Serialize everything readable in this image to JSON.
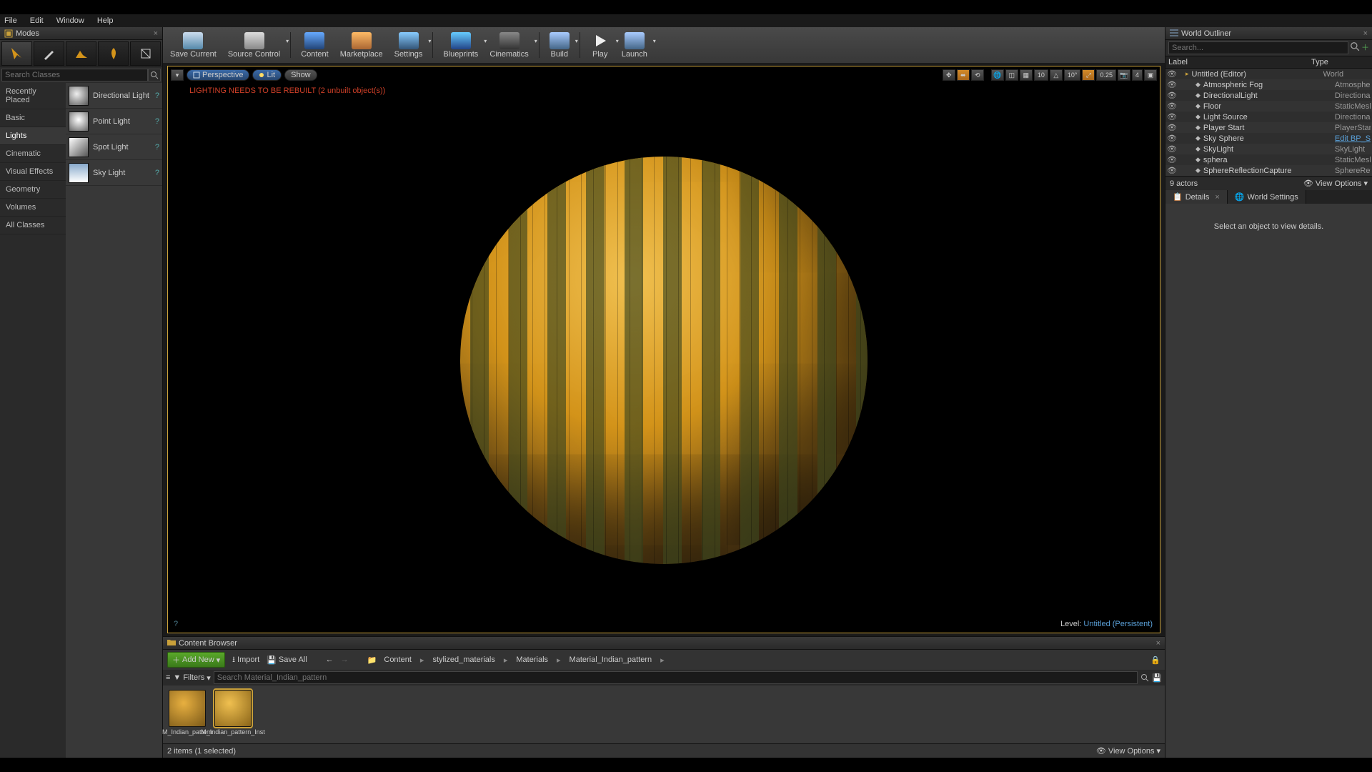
{
  "menu": {
    "file": "File",
    "edit": "Edit",
    "window": "Window",
    "help": "Help"
  },
  "modes": {
    "tab": "Modes",
    "search_placeholder": "Search Classes",
    "categories": [
      "Recently Placed",
      "Basic",
      "Lights",
      "Cinematic",
      "Visual Effects",
      "Geometry",
      "Volumes",
      "All Classes"
    ],
    "selected_category": "Lights",
    "lights": [
      "Directional Light",
      "Point Light",
      "Spot Light",
      "Sky Light"
    ]
  },
  "toolbar": {
    "save": "Save Current",
    "source": "Source Control",
    "content": "Content",
    "marketplace": "Marketplace",
    "settings": "Settings",
    "blueprints": "Blueprints",
    "cinematics": "Cinematics",
    "build": "Build",
    "play": "Play",
    "launch": "Launch"
  },
  "viewport": {
    "perspective": "Perspective",
    "lit": "Lit",
    "show": "Show",
    "warning": "LIGHTING NEEDS TO BE REBUILT (2 unbuilt object(s))",
    "snap_deg": "10",
    "snap_deg2": "10°",
    "snap_scale": "0.25",
    "cam_speed": "4",
    "level_label": "Level:",
    "level_name": "Untitled (Persistent)"
  },
  "outliner": {
    "tab": "World Outliner",
    "search_placeholder": "Search...",
    "col_label": "Label",
    "col_type": "Type",
    "rows": [
      {
        "indent": 0,
        "name": "Untitled (Editor)",
        "type": "World"
      },
      {
        "indent": 1,
        "name": "Atmospheric Fog",
        "type": "AtmosphericFog"
      },
      {
        "indent": 1,
        "name": "DirectionalLight",
        "type": "DirectionalLight"
      },
      {
        "indent": 1,
        "name": "Floor",
        "type": "StaticMeshActor"
      },
      {
        "indent": 1,
        "name": "Light Source",
        "type": "DirectionalLight"
      },
      {
        "indent": 1,
        "name": "Player Start",
        "type": "PlayerStart"
      },
      {
        "indent": 1,
        "name": "Sky Sphere",
        "type": "Edit BP_Sky_Sphere",
        "link": true
      },
      {
        "indent": 1,
        "name": "SkyLight",
        "type": "SkyLight"
      },
      {
        "indent": 1,
        "name": "sphera",
        "type": "StaticMeshActor"
      },
      {
        "indent": 1,
        "name": "SphereReflectionCapture",
        "type": "SphereReflectionC"
      }
    ],
    "count": "9 actors",
    "view_options": "View Options"
  },
  "details": {
    "tab1": "Details",
    "tab2": "World Settings",
    "empty": "Select an object to view details."
  },
  "cbrowser": {
    "tab": "Content Browser",
    "add_new": "Add New",
    "import": "Import",
    "save_all": "Save All",
    "crumbs": [
      "Content",
      "stylized_materials",
      "Materials",
      "Material_Indian_pattern"
    ],
    "filters": "Filters",
    "search_placeholder": "Search Material_Indian_pattern",
    "assets": [
      {
        "name": "M_Indian_pattern"
      },
      {
        "name": "M_Indian_pattern_Inst",
        "selected": true
      }
    ],
    "status": "2 items (1 selected)",
    "view_options": "View Options"
  }
}
